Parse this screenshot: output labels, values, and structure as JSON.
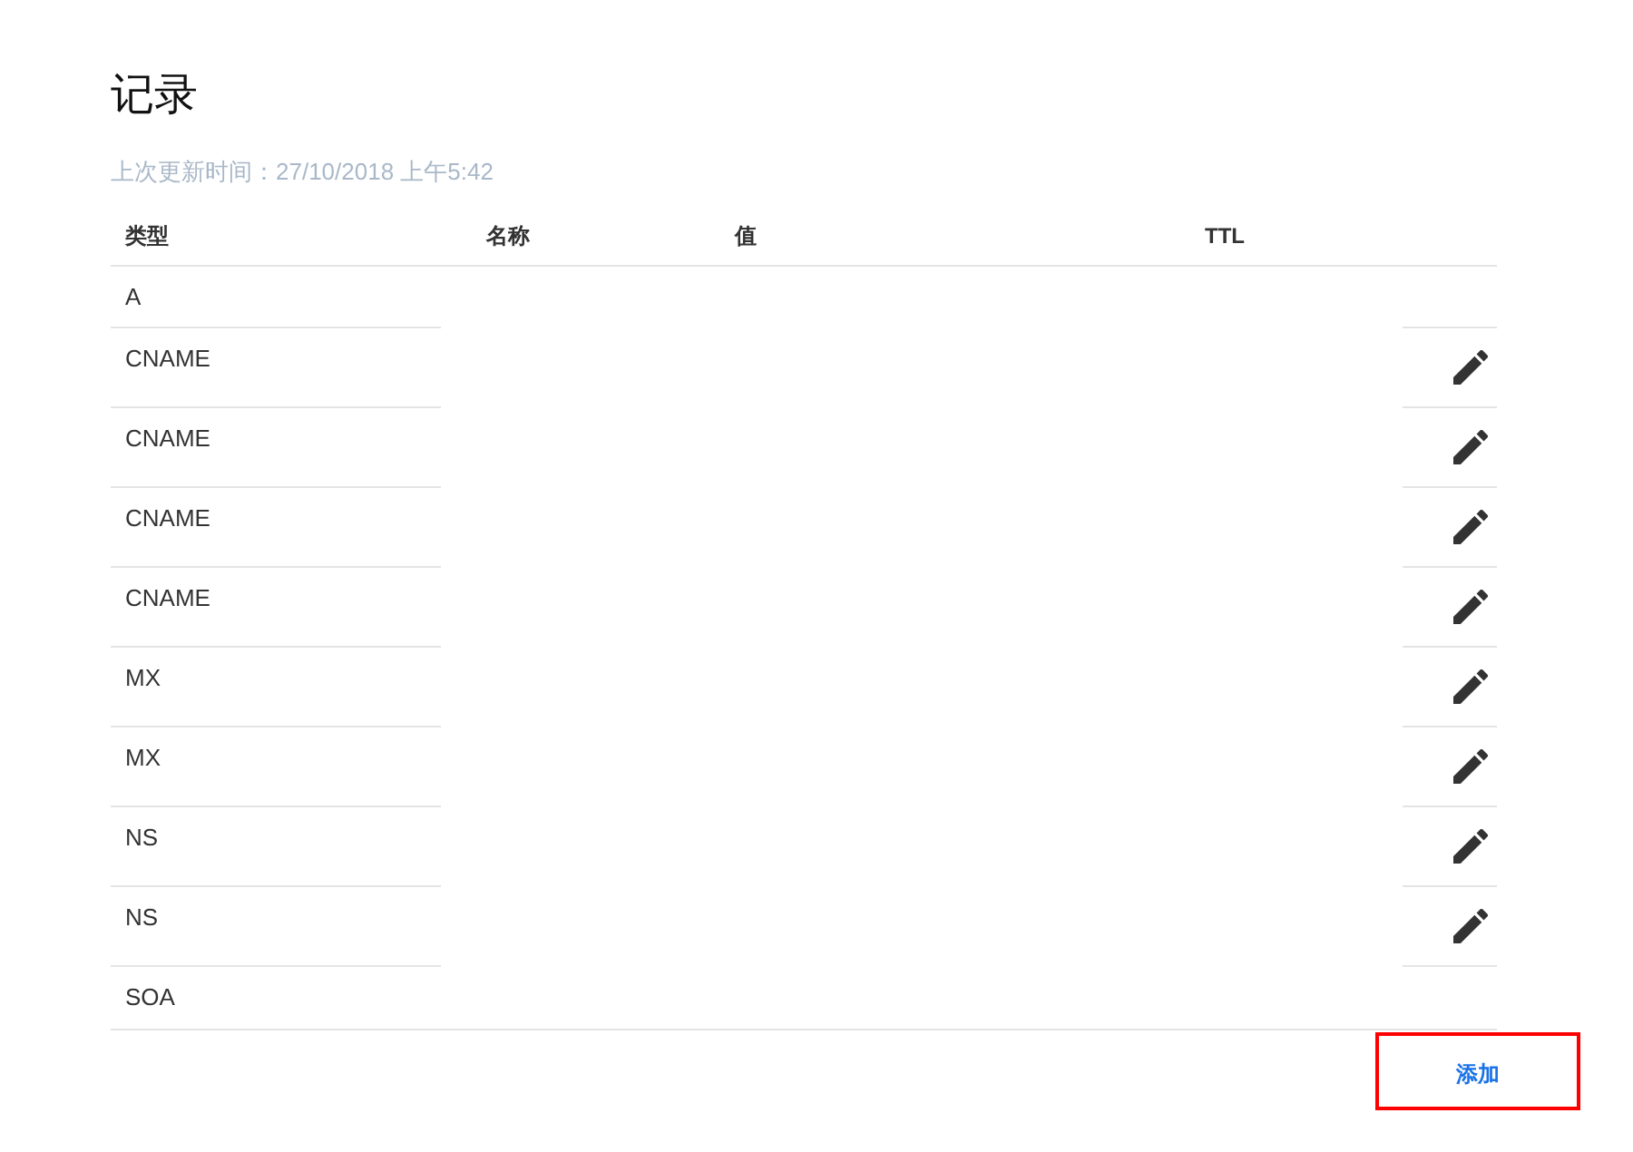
{
  "page": {
    "title": "记录",
    "last_updated": "上次更新时间：27/10/2018 上午5:42"
  },
  "table": {
    "columns": [
      "类型",
      "名称",
      "值",
      "TTL"
    ],
    "rows": [
      {
        "type": "A",
        "editable": false
      },
      {
        "type": "CNAME",
        "editable": true
      },
      {
        "type": "CNAME",
        "editable": true
      },
      {
        "type": "CNAME",
        "editable": true
      },
      {
        "type": "CNAME",
        "editable": true
      },
      {
        "type": "MX",
        "editable": true
      },
      {
        "type": "MX",
        "editable": true
      },
      {
        "type": "NS",
        "editable": true
      },
      {
        "type": "NS",
        "editable": true
      },
      {
        "type": "SOA",
        "editable": false
      }
    ]
  },
  "add_button": {
    "label": "添加",
    "highlighted": true
  }
}
